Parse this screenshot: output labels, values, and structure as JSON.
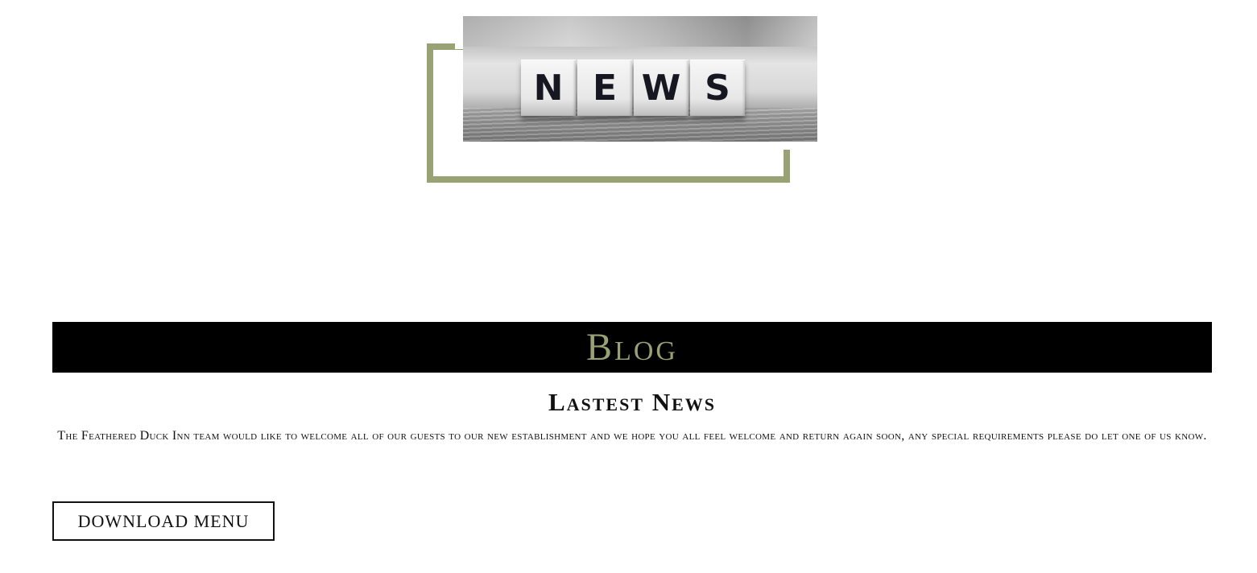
{
  "hero": {
    "image_semantic": "news-letter-tiles",
    "tiles": [
      "N",
      "E",
      "W",
      "S"
    ],
    "frame_color": "#98a274"
  },
  "blog": {
    "title": "Blog",
    "title_color": "#98a274",
    "banner_color": "#000000"
  },
  "latest_news": {
    "heading": "Lastest News",
    "body": "The Feathered Duck Inn team would like to welcome all of our guests to our new establishment and we hope you all feel welcome and return again soon, any special requirements please do let one of us know."
  },
  "actions": {
    "download_menu_label": "DOWNLOAD MENU"
  }
}
